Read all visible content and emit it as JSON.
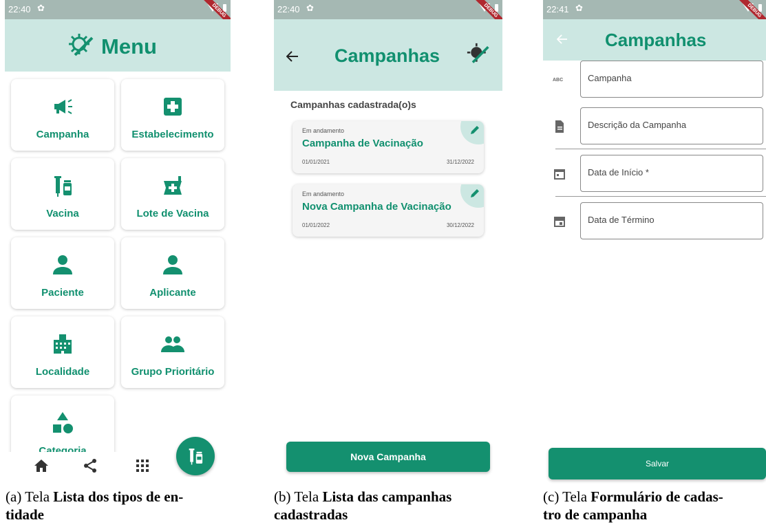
{
  "screens": {
    "a": {
      "status_time": "22:40",
      "debug_ribbon": "DEBUG",
      "title": "Menu",
      "tiles": [
        {
          "label": "Campanha",
          "icon": "megaphone-icon"
        },
        {
          "label": "Estabelecimento",
          "icon": "medical-plus-icon"
        },
        {
          "label": "Vacina",
          "icon": "vaccine-vials-icon"
        },
        {
          "label": "Lote de Vacina",
          "icon": "medical-bag-icon"
        },
        {
          "label": "Paciente",
          "icon": "person-icon"
        },
        {
          "label": "Aplicante",
          "icon": "person-icon"
        },
        {
          "label": "Localidade",
          "icon": "buildings-icon"
        },
        {
          "label": "Grupo Prioritário",
          "icon": "group-icon"
        },
        {
          "label": "Categoria",
          "icon": "shapes-icon"
        }
      ],
      "bottom_nav": [
        "home-icon",
        "share-icon",
        "grid-icon"
      ],
      "fab_icon": "vaccine-vials-icon"
    },
    "b": {
      "status_time": "22:40",
      "title": "Campanhas",
      "section_title": "Campanhas cadastrada(o)s",
      "cards": [
        {
          "status": "Em andamento",
          "name": "Campanha de Vacinação",
          "start": "01/01/2021",
          "end": "31/12/2022"
        },
        {
          "status": "Em andamento",
          "name": "Nova Campanha de Vacinação",
          "start": "01/01/2022",
          "end": "30/12/2022"
        }
      ],
      "button": "Nova Campanha"
    },
    "c": {
      "status_time": "22:41",
      "title": "Campanhas",
      "fields": [
        {
          "label": "Campanha",
          "icon": "abc-text-icon"
        },
        {
          "label": "Descrição da Campanha",
          "icon": "document-icon"
        },
        {
          "label": "Data de Início *",
          "icon": "calendar-today-icon"
        },
        {
          "label": "Data de Término",
          "icon": "calendar-icon"
        }
      ],
      "button": "Salvar"
    }
  },
  "captions": {
    "a": {
      "prefix": "(a) Tela ",
      "bold": "Lista dos tipos de en-",
      "line2": "tidade"
    },
    "b": {
      "prefix": "(b) Tela ",
      "bold": "Lista das campanhas",
      "line2": "cadastradas"
    },
    "c": {
      "prefix": "(c) Tela ",
      "bold": "Formulário de cadas-",
      "line2": "tro de campanha"
    }
  },
  "colors": {
    "primary": "#14906f",
    "appbar": "#cce7e2",
    "statusbar": "#a5b8b3",
    "debug": "#b0282f"
  }
}
